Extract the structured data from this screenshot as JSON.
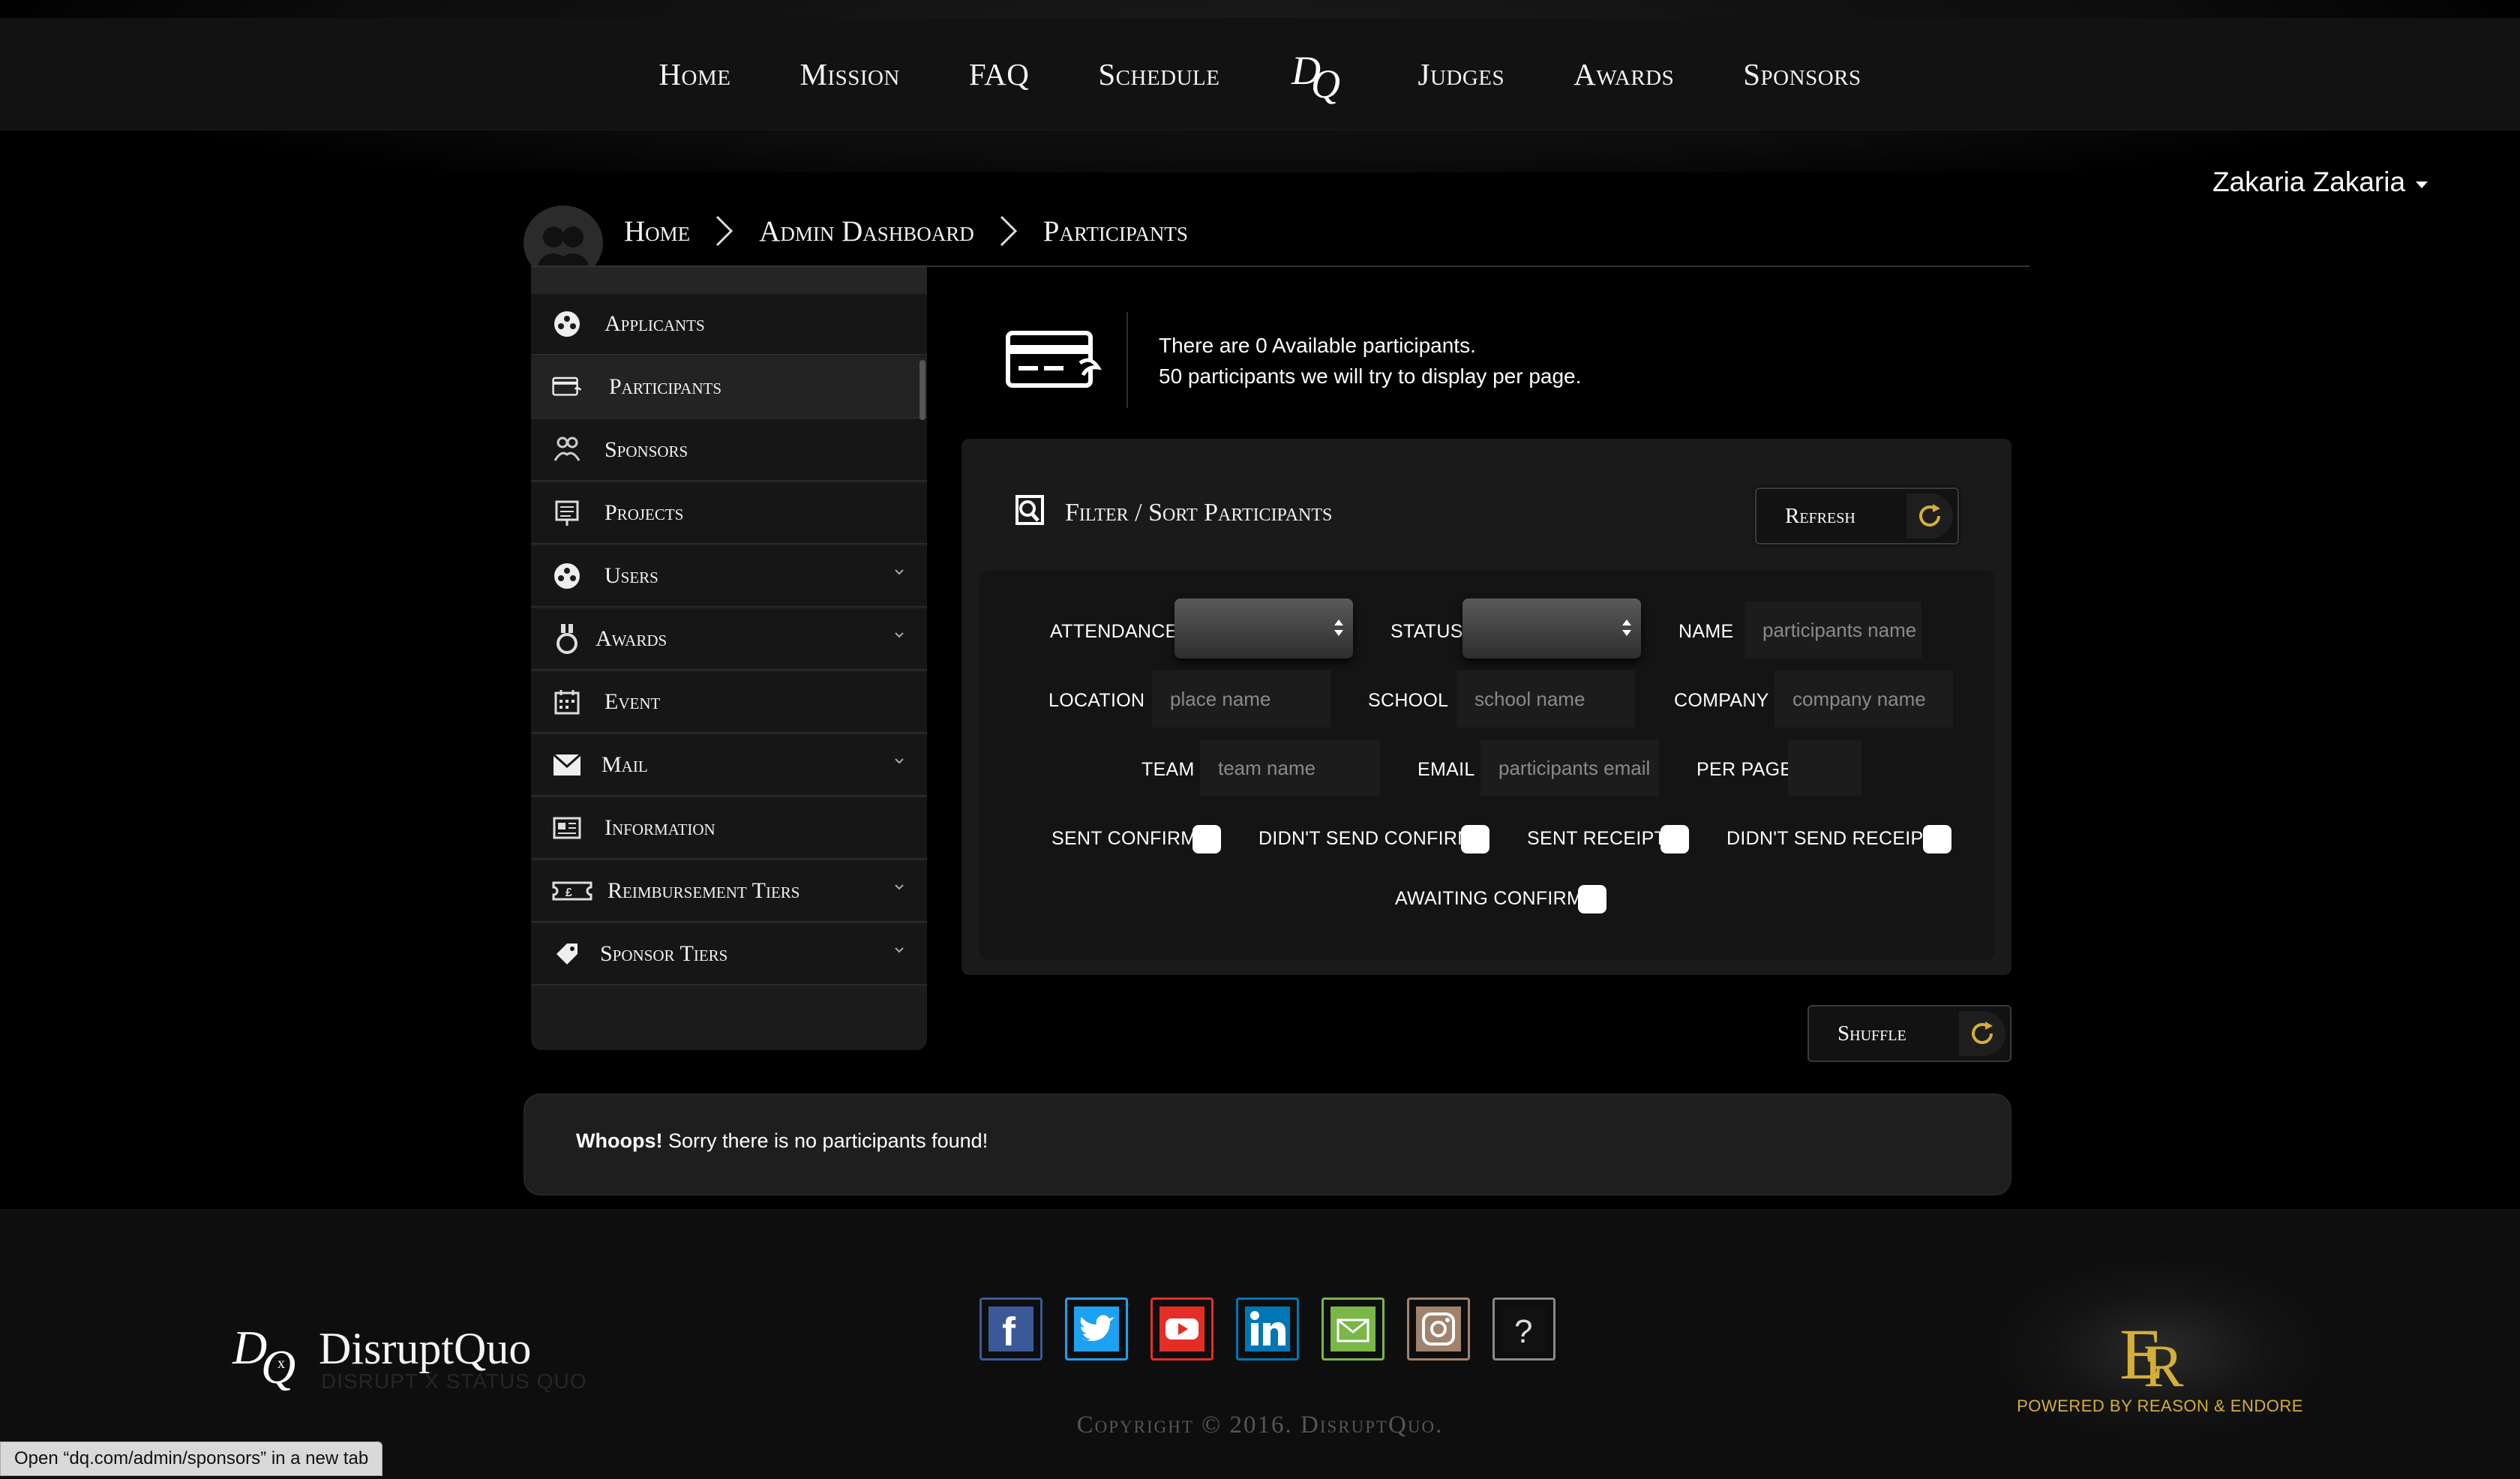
{
  "nav": {
    "items_left": [
      "Home",
      "Mission",
      "FAQ",
      "Schedule"
    ],
    "logo": "DQ",
    "items_right": [
      "Judges",
      "Awards",
      "Sponsors"
    ]
  },
  "user": {
    "name": "Zakaria Zakaria"
  },
  "breadcrumb": [
    "Home",
    "Admin Dashboard",
    "Participants"
  ],
  "sidebar": {
    "items": [
      {
        "label": "Applicants",
        "icon": "applicants-icon"
      },
      {
        "label": "Participants",
        "icon": "credit-card-icon"
      },
      {
        "label": "Sponsors",
        "icon": "handshake-icon"
      },
      {
        "label": "Projects",
        "icon": "presentation-board-icon"
      },
      {
        "label": "Users",
        "icon": "users-icon"
      },
      {
        "label": "Awards",
        "icon": "medal-icon"
      },
      {
        "label": "Event",
        "icon": "calendar-icon"
      },
      {
        "label": "Mail",
        "icon": "envelope-icon"
      },
      {
        "label": "Information",
        "icon": "newspaper-icon"
      },
      {
        "label": "Reimbursement Tiers",
        "icon": "ticket-icon"
      },
      {
        "label": "Sponsor Tiers",
        "icon": "tag-icon"
      }
    ]
  },
  "info": {
    "line1": "There are 0 Available participants.",
    "line2": "50 participants we will try to display per page."
  },
  "filter": {
    "title": "Filter / Sort Participants",
    "refresh_label": "Refresh",
    "labels": {
      "attendance": "ATTENDANCE",
      "status": "STATUS",
      "name": "NAME",
      "location": "LOCATION",
      "school": "SCHOOL",
      "company": "COMPANY",
      "team": "TEAM",
      "email": "EMAIL",
      "per_page": "PER PAGE",
      "sent_confirm": "SENT CONFIRM",
      "didnt_send_confirm": "DIDN'T SEND CONFIRM",
      "sent_receipts": "SENT RECEIPTS",
      "didnt_send_receipts": "DIDN'T SEND RECEIPTS",
      "awaiting_confirm": "AWAITING CONFIRM"
    },
    "placeholders": {
      "name": "participants name",
      "location": "place name",
      "school": "school name",
      "company": "company name",
      "team": "team name",
      "email": "participants email"
    }
  },
  "shuffle_label": "Shuffle",
  "whoops": {
    "strong": "Whoops!",
    "text": " Sorry there is no participants found!"
  },
  "footer": {
    "brand": "DisruptQuo",
    "tagline": "DISRUPT X STATUS QUO",
    "copyright": "Copyright © 2016. DisruptQuo.",
    "powered": "POWERED BY REASON & ENDORE",
    "social": [
      {
        "name": "facebook-icon",
        "color": "#3b5998"
      },
      {
        "name": "twitter-icon",
        "color": "#1da1f2"
      },
      {
        "name": "youtube-icon",
        "color": "#e52d27"
      },
      {
        "name": "linkedin-icon",
        "color": "#0077b5"
      },
      {
        "name": "mail-icon",
        "color": "#7ab648"
      },
      {
        "name": "instagram-icon",
        "color": "#a0826d"
      },
      {
        "name": "help-icon",
        "color": "#888888"
      }
    ]
  },
  "status_bar": "Open “dq.com/admin/sponsors” in a new tab"
}
